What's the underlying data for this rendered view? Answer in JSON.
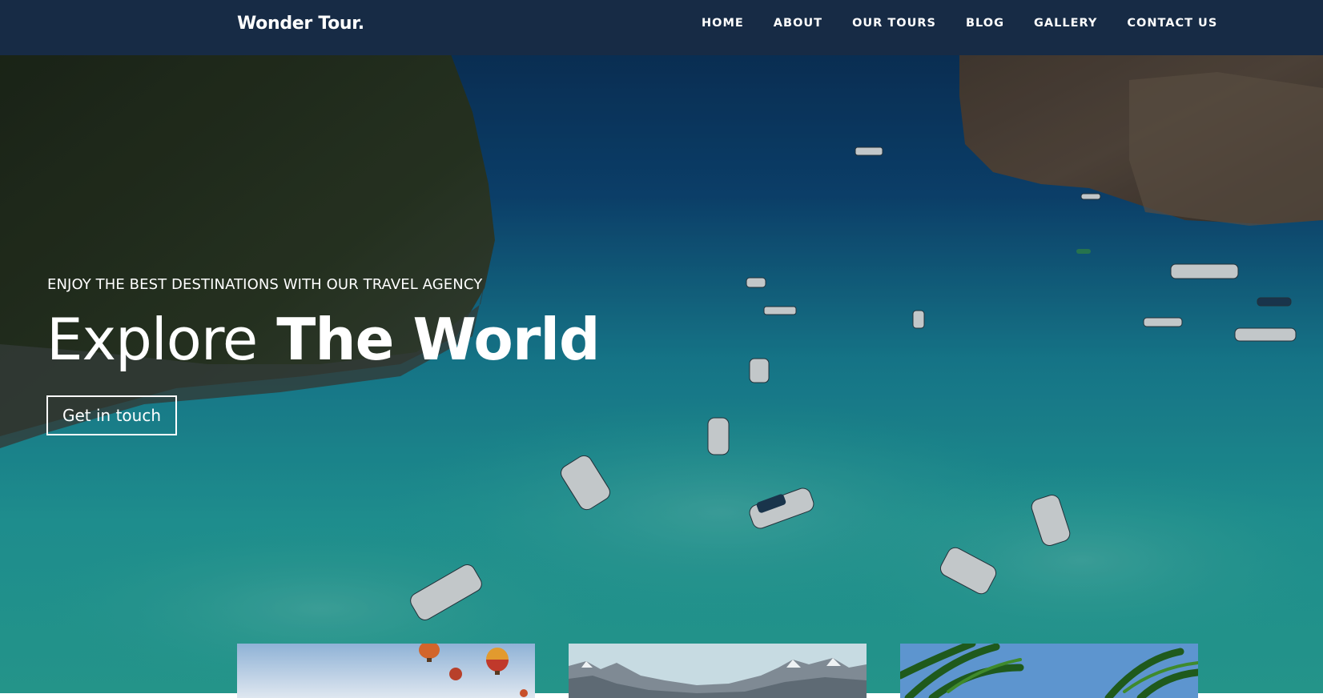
{
  "brand": {
    "name": "Wonder Tour."
  },
  "nav": {
    "items": [
      {
        "label": "HOME"
      },
      {
        "label": "ABOUT"
      },
      {
        "label": "OUR TOURS"
      },
      {
        "label": "BLOG"
      },
      {
        "label": "GALLERY"
      },
      {
        "label": "CONTACT US"
      }
    ]
  },
  "hero": {
    "kicker": "ENJOY THE BEST DESTINATIONS WITH OUR TRAVEL AGENCY",
    "headline_light": "Explore",
    "headline_bold": "The World",
    "cta_label": "Get in touch"
  },
  "colors": {
    "navbar": "#172b45",
    "text": "#ffffff",
    "water_deep": "#0d3a66",
    "water_shallow": "#1ea6a8"
  },
  "cards": [
    {
      "icon": "hot-air-balloon-image"
    },
    {
      "icon": "mountain-image"
    },
    {
      "icon": "palm-tree-image"
    }
  ]
}
